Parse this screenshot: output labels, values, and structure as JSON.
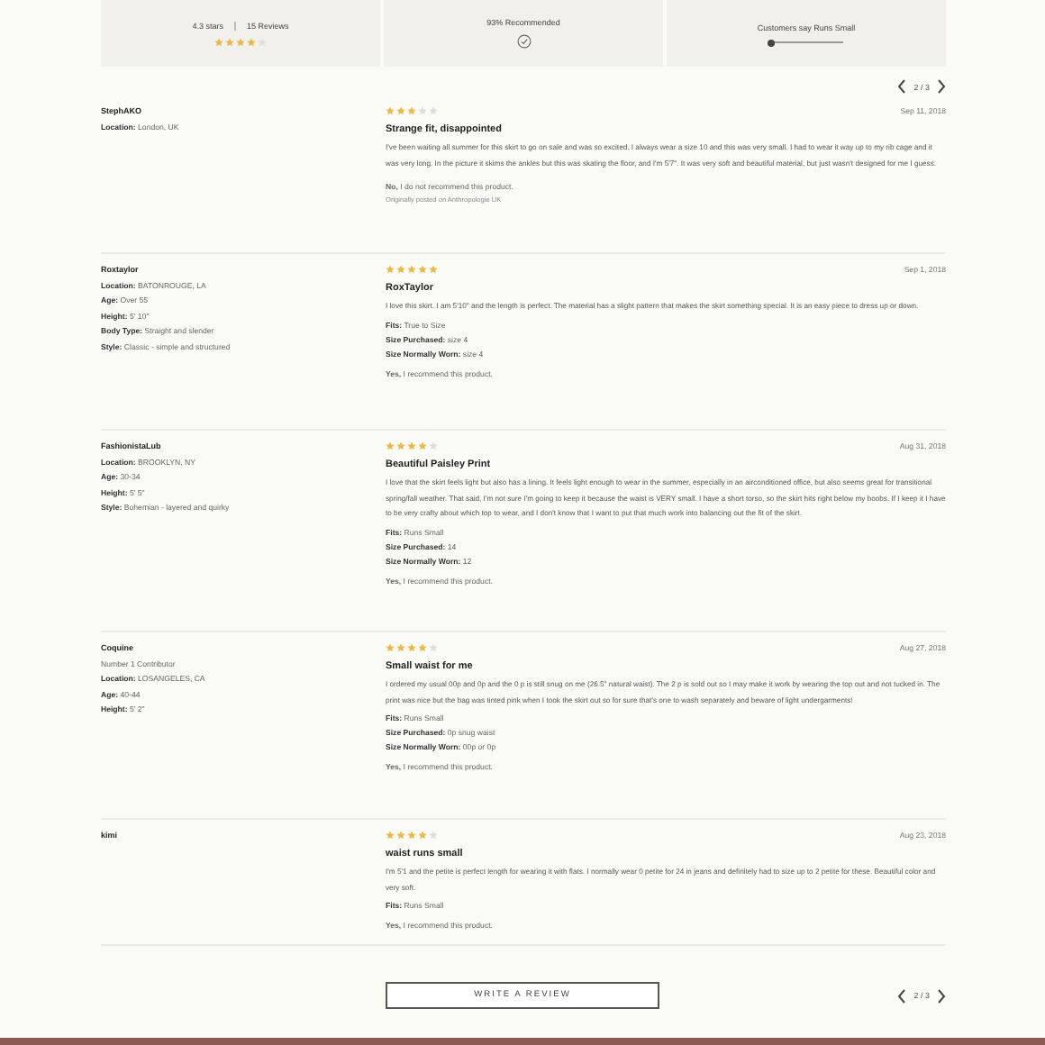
{
  "summary": {
    "rating": "4.3 stars",
    "reviews": "15 Reviews",
    "stars": 4,
    "recommended": "93% Recommended",
    "fit_label": "Customers say Runs Small",
    "fit_scale": {
      "level": 0
    }
  },
  "top_pager": {
    "page": "2 / 3"
  },
  "reviews": [
    {
      "author": "StephAKO",
      "profile": [
        {
          "label": "Location:",
          "value": "London, UK"
        }
      ],
      "stars": 3,
      "date": "Sep 11, 2018",
      "title": "Strange fit, disappointed",
      "body": "I've been waiting all summer for this skirt to go on sale and was so excited. I always wear a size 10 and this was very small. I had to wear it way up to my rib cage and it was very long. In the picture it skims the ankles but this was skating the floor, and I'm 5'7\". It was very soft and beautiful material, but just wasn't designed for me I guess.",
      "recommend": "**No,** I do not recommend this product.",
      "note": "Originally posted on Anthropologie UK"
    },
    {
      "author": "Roxtaylor",
      "profile": [
        {
          "label": "Location:",
          "value": "BATONROUGE, LA"
        },
        {
          "label": "Age:",
          "value": "Over 55"
        },
        {
          "label": "Height:",
          "value": "5' 10\""
        },
        {
          "label": "Body Type:",
          "value": "Straight and slender"
        },
        {
          "label": "Style:",
          "value": "Classic - simple and structured"
        }
      ],
      "stars": 5,
      "date": "Sep 1, 2018",
      "title": "RoxTaylor",
      "body": "I love this skirt. I am 5'10\" and the length is perfect. The material has a slight pattern that makes the skirt something special. It is an easy piece to dress up or down.",
      "details": [
        {
          "label": "Fits:",
          "value": "True to Size"
        },
        {
          "label": "Size Purchased:",
          "value": "size 4"
        },
        {
          "label": "Size Normally Worn:",
          "value": "size 4"
        }
      ],
      "recommend": "**Yes,** I recommend this product."
    },
    {
      "author": "FashionistaLub",
      "profile": [
        {
          "label": "Location:",
          "value": "BROOKLYN, NY"
        },
        {
          "label": "Age:",
          "value": "30-34"
        },
        {
          "label": "Height:",
          "value": "5' 5\""
        },
        {
          "label": "Style:",
          "value": "Bohemian - layered and quirky"
        }
      ],
      "stars": 4,
      "date": "Aug 31, 2018",
      "title": "Beautiful Paisley Print",
      "body": "I love that the skirt feels light but also has a lining. It feels light enough to wear in the summer, especially in an airconditioned office, but also seems great for transitional spring/fall weather. That said, I'm not sure I'm going to keep it because the waist is VERY small. I have a short torso, so the skirt hits right below my boobs. If I keep it I have to be very crafty about which top to wear, and I don't know that I want to put that much work into balancing out the fit of the skirt.",
      "details": [
        {
          "label": "Fits:",
          "value": "Runs Small"
        },
        {
          "label": "Size Purchased:",
          "value": "14"
        },
        {
          "label": "Size Normally Worn:",
          "value": "12"
        }
      ],
      "recommend": "**Yes,** I recommend this product."
    },
    {
      "author": "Coquine",
      "subtitle": "Number 1 Contributor",
      "profile": [
        {
          "label": "Location:",
          "value": "LOSANGELES, CA"
        },
        {
          "label": "Age:",
          "value": "40-44"
        },
        {
          "label": "Height:",
          "value": "5' 2\""
        }
      ],
      "stars": 4,
      "date": "Aug 27, 2018",
      "title": "Small waist for me",
      "body": "I ordered my usual 00p and 0p and the 0 p is still snug on me (26.5\" natural waist). The 2 p is sold out so I may make it work by wearing the top out and not tucked in. The print was nice but the bag was tinted pink when I took the skirt out so for sure that's one to wash separately and beware of light undergarments!",
      "details": [
        {
          "label": "Fits:",
          "value": "Runs Small"
        },
        {
          "label": "Size Purchased:",
          "value": "0p snug waist"
        },
        {
          "label": "Size Normally Worn:",
          "value": "00p or 0p"
        }
      ],
      "recommend": "**Yes,** I recommend this product."
    },
    {
      "author": "kimi",
      "stars": 4,
      "date": "Aug 23, 2018",
      "title": "waist runs small",
      "body": "I'm 5'1 and the petite is perfect length for wearing it with flats. I normally wear 0 petite for 24 in jeans and definitely had to size up to 2 petite for these. Beautiful color and very soft.",
      "details": [
        {
          "label": "Fits:",
          "value": "Runs Small"
        }
      ],
      "recommend": "**Yes,** I recommend this product."
    }
  ],
  "write_review": "WRITE A REVIEW",
  "bottom_pager": {
    "page": "2 / 3"
  }
}
